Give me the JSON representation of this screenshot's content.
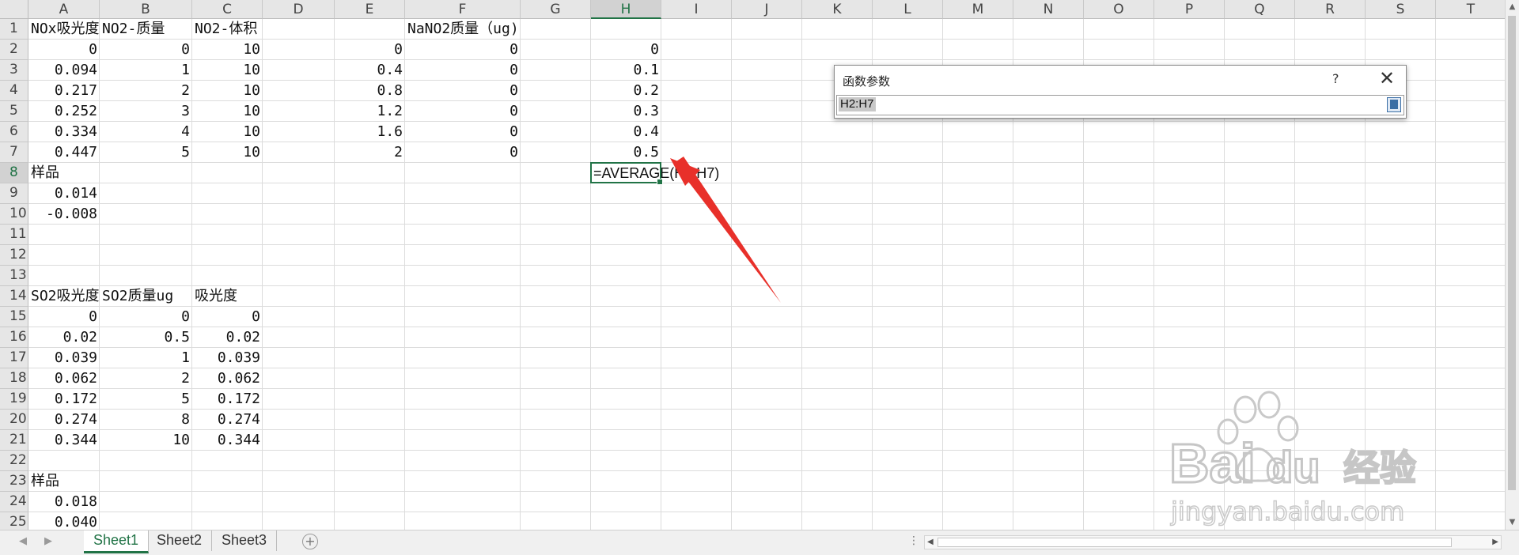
{
  "columns": [
    "A",
    "B",
    "C",
    "D",
    "E",
    "F",
    "G",
    "H",
    "I",
    "J",
    "K",
    "L",
    "M",
    "N",
    "O",
    "P",
    "Q",
    "R",
    "S",
    "T"
  ],
  "rows": [
    "1",
    "2",
    "3",
    "4",
    "5",
    "6",
    "7",
    "8",
    "9",
    "10",
    "11",
    "12",
    "13",
    "14",
    "15",
    "16",
    "17",
    "18",
    "19",
    "20",
    "21",
    "22",
    "23",
    "24",
    "25"
  ],
  "selected_column": "H",
  "selected_row": "8",
  "cells": {
    "A1": "NOx吸光度",
    "B1": "NO2-质量",
    "C1": "NO2-体积",
    "F1": "NaNO2质量（ug)",
    "A2": "0",
    "B2": "0",
    "C2": "10",
    "E2": "0",
    "F2": "0",
    "H2": "0",
    "A3": "0.094",
    "B3": "1",
    "C3": "10",
    "E3": "0.4",
    "F3": "0",
    "H3": "0.1",
    "A4": "0.217",
    "B4": "2",
    "C4": "10",
    "E4": "0.8",
    "F4": "0",
    "H4": "0.2",
    "A5": "0.252",
    "B5": "3",
    "C5": "10",
    "E5": "1.2",
    "F5": "0",
    "H5": "0.3",
    "A6": "0.334",
    "B6": "4",
    "C6": "10",
    "E6": "1.6",
    "F6": "0",
    "H6": "0.4",
    "A7": "0.447",
    "B7": "5",
    "C7": "10",
    "E7": "2",
    "F7": "0",
    "H7": "0.5",
    "A8": "样品",
    "H8": "=AVERAGE(H2:H7)",
    "A9": "0.014",
    "A10": "-0.008",
    "A14": "SO2吸光度",
    "B14": "SO2质量ug",
    "C14": "吸光度",
    "A15": "0",
    "B15": "0",
    "C15": "0",
    "A16": "0.02",
    "B16": "0.5",
    "C16": "0.02",
    "A17": "0.039",
    "B17": "1",
    "C17": "0.039",
    "A18": "0.062",
    "B18": "2",
    "C18": "0.062",
    "A19": "0.172",
    "B19": "5",
    "C19": "0.172",
    "A20": "0.274",
    "B20": "8",
    "C20": "0.274",
    "A21": "0.344",
    "B21": "10",
    "C21": "0.344",
    "A23": "样品",
    "A24": "0.018",
    "A25": "0.040"
  },
  "dialog": {
    "title": "函数参数",
    "help": "?",
    "close": "✕",
    "input_value": "H2:H7"
  },
  "sheets": [
    "Sheet1",
    "Sheet2",
    "Sheet3"
  ],
  "active_sheet": "Sheet1",
  "add_sheet": "+",
  "nav": {
    "prev": "◀",
    "next": "▶"
  },
  "watermark": {
    "brand_a": "Bai",
    "brand_b": "du",
    "brand_c": "经验",
    "url": "jingyan.baidu.com"
  },
  "colors": {
    "accent": "#217346",
    "arrow": "#e8302a"
  },
  "icons": {
    "collapse": "collapse-dialog-icon",
    "arrow": "red-arrow-annotation"
  }
}
